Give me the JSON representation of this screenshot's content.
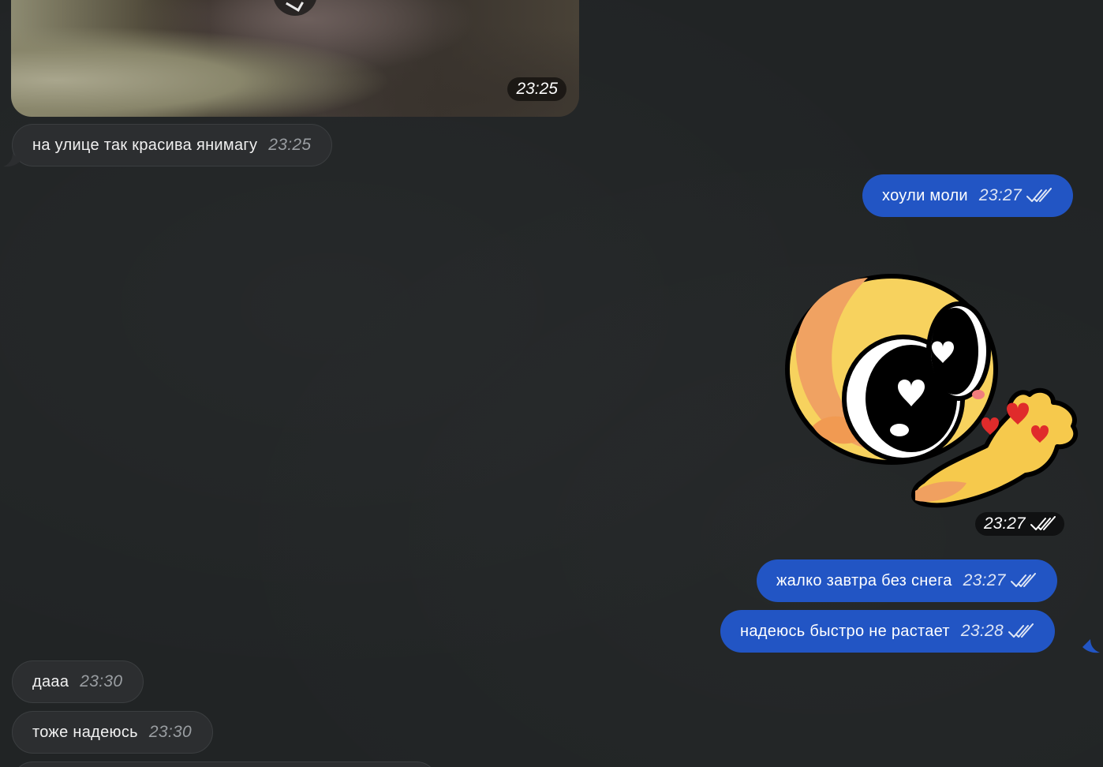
{
  "messages": [
    {
      "type": "photo",
      "direction": "in",
      "time": "23:25"
    },
    {
      "type": "text",
      "direction": "in",
      "text": "на улице так красива янимагу",
      "time": "23:25"
    },
    {
      "type": "text",
      "direction": "out",
      "text": "хоули моли",
      "time": "23:27",
      "status": "read"
    },
    {
      "type": "sticker",
      "direction": "out",
      "sticker": "cursed-emoji-heart-eyes",
      "time": "23:27",
      "status": "read"
    },
    {
      "type": "text",
      "direction": "out",
      "text": "жалко завтра без снега",
      "time": "23:27",
      "status": "read"
    },
    {
      "type": "text",
      "direction": "out",
      "text": "надеюсь быстро не растает",
      "time": "23:28",
      "status": "read"
    },
    {
      "type": "text",
      "direction": "in",
      "text": "дааа",
      "time": "23:30"
    },
    {
      "type": "text",
      "direction": "in",
      "text": "тоже надеюсь",
      "time": "23:30"
    }
  ],
  "icons": {
    "read_status": "double-check-icon",
    "photo_overlay": "play-icon"
  },
  "colors": {
    "background": "#212425",
    "incoming_bubble": "#2c2e30",
    "outgoing_bubble": "#2255c4"
  }
}
